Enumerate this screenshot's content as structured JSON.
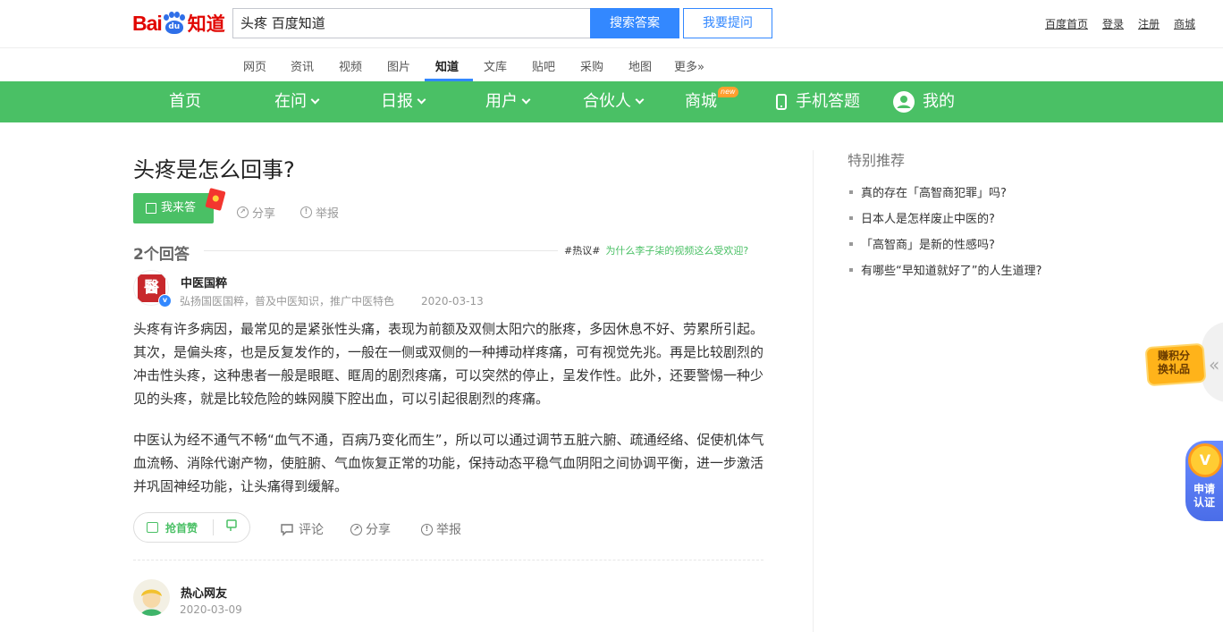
{
  "header": {
    "logo_bai": "Bai",
    "logo_du": "du",
    "logo_zhidao": "知道",
    "search_value": "头疼 百度知道",
    "search_button": "搜索答案",
    "ask_button": "我要提问",
    "top_links": [
      "百度首页",
      "登录",
      "注册",
      "商城"
    ]
  },
  "channels": [
    "网页",
    "资讯",
    "视频",
    "图片",
    "知道",
    "文库",
    "贴吧",
    "采购",
    "地图",
    "更多»"
  ],
  "active_channel": "知道",
  "green_nav": {
    "home": "首页",
    "asking": "在问",
    "daily": "日报",
    "user": "用户",
    "partner": "合伙人",
    "mall": "商城",
    "mall_badge": "new",
    "mobile": "手机答题",
    "mine": "我的"
  },
  "question": {
    "title": "头疼是怎么回事?",
    "answer_button": "我来答",
    "share": "分享",
    "report": "举报"
  },
  "answers_header": {
    "count": "2个回答",
    "hot_tag": "#热议#",
    "hot_question": "为什么李子柒的视频这么受欢迎?"
  },
  "answer1": {
    "seal_char": "醫",
    "verified": "v",
    "user": "中医国粹",
    "desc": "弘扬国医国粹，普及中医知识，推广中医特色",
    "date": "2020-03-13",
    "para1": "头疼有许多病因，最常见的是紧张性头痛，表现为前额及双侧太阳穴的胀疼，多因休息不好、劳累所引起。其次，是偏头疼，也是反复发作的，一般在一侧或双侧的一种搏动样疼痛，可有视觉先兆。再是比较剧烈的冲击性头疼，这种患者一般是眼眶、眶周的剧烈疼痛，可以突然的停止，呈发作性。此外，还要警惕一种少见的头疼，就是比较危险的蛛网膜下腔出血，可以引起很剧烈的疼痛。",
    "para2": "中医认为经不通气不畅“血气不通，百病乃变化而生”，所以可以通过调节五脏六腑、疏通经络、促使机体气血流畅、消除代谢产物，使脏腑、气血恢复正常的功能，保持动态平稳气血阴阳之间协调平衡，进一步激活并巩固神经功能，让头痛得到缓解。",
    "like": "抢首赞",
    "comment": "评论",
    "share": "分享",
    "report": "举报"
  },
  "answer2": {
    "user": "热心网友",
    "date": "2020-03-09"
  },
  "sidebar": {
    "title": "特别推荐",
    "items": [
      "真的存在「高智商犯罪」吗?",
      "日本人是怎样废止中医的?",
      "「高智商」是新的性感吗?",
      "有哪些“早知道就好了”的人生道理?"
    ]
  },
  "floats": {
    "points_line1": "赚积分",
    "points_line2": "换礼品",
    "cert_coin": "V",
    "cert_line1": "申请",
    "cert_line2": "认证"
  },
  "colors": {
    "brand_red": "#e10601",
    "accent_blue": "#3388ff",
    "nav_green": "#4ac065"
  }
}
